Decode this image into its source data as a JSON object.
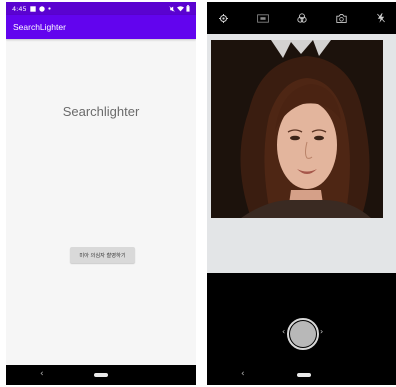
{
  "status_bar": {
    "time": "4:45",
    "left_icons": [
      "image-icon",
      "messenger-icon",
      "dot-icon"
    ],
    "right_icons": [
      "no-sound-icon",
      "wifi-icon",
      "battery-icon"
    ]
  },
  "app_bar": {
    "title": "SearchLighter"
  },
  "main": {
    "heading": "Searchlighter",
    "suspect_button_label": "미아 의심자 촬영하기"
  },
  "camera": {
    "toolbar_icons": [
      "settings-icon",
      "aspect-ratio-icon",
      "filter-icon",
      "switch-camera-icon",
      "flash-off-icon"
    ],
    "previous_arrow": "‹",
    "next_arrow": "›"
  },
  "nav_bar": {
    "back_glyph": "‹"
  },
  "colors": {
    "status_bar": "#5a03d0",
    "app_bar": "#6204ee",
    "screen_bg": "#f6f6f6",
    "button_bg": "#d9d9d9",
    "camera_bg": "#000000",
    "camera_preview": "#e3e5e7"
  }
}
